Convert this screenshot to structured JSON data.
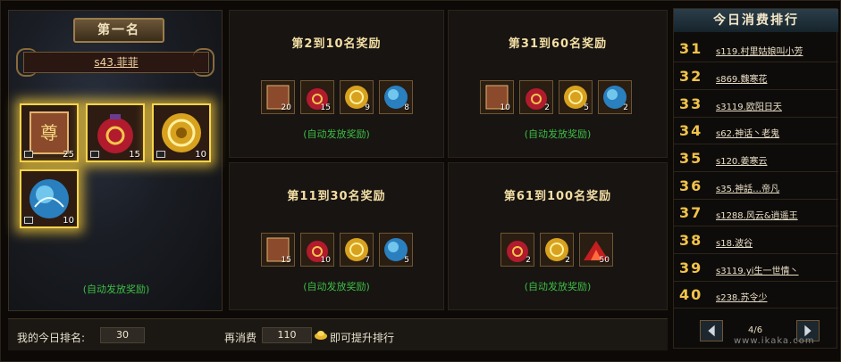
{
  "first_place": {
    "title": "第一名",
    "player": "s43.菲菲",
    "auto_send": "(自动发放奖励)",
    "items": [
      {
        "icon": "token-card-icon",
        "count": "25"
      },
      {
        "icon": "red-bag-icon",
        "count": "15"
      },
      {
        "icon": "gold-coin-icon",
        "count": "10"
      },
      {
        "icon": "blue-orb-icon",
        "count": "10"
      }
    ]
  },
  "reward_panels": [
    {
      "title": "第2到10名奖励",
      "auto_send": "(自动发放奖励)",
      "items": [
        {
          "icon": "token-card-icon",
          "count": "20"
        },
        {
          "icon": "red-bag-icon",
          "count": "15"
        },
        {
          "icon": "gold-coin-icon",
          "count": "9"
        },
        {
          "icon": "blue-orb-icon",
          "count": "8"
        }
      ]
    },
    {
      "title": "第31到60名奖励",
      "auto_send": "(自动发放奖励)",
      "items": [
        {
          "icon": "token-card-icon",
          "count": "10"
        },
        {
          "icon": "red-bag-icon",
          "count": "2"
        },
        {
          "icon": "gold-coin-icon",
          "count": "5"
        },
        {
          "icon": "blue-orb-icon",
          "count": "2"
        }
      ]
    },
    {
      "title": "第11到30名奖励",
      "auto_send": "(自动发放奖励)",
      "items": [
        {
          "icon": "token-card-icon",
          "count": "15"
        },
        {
          "icon": "red-bag-icon",
          "count": "10"
        },
        {
          "icon": "gold-coin-icon",
          "count": "7"
        },
        {
          "icon": "blue-orb-icon",
          "count": "5"
        }
      ]
    },
    {
      "title": "第61到100名奖励",
      "auto_send": "(自动发放奖励)",
      "items": [
        {
          "icon": "red-bag-icon",
          "count": "2"
        },
        {
          "icon": "gold-coin-icon",
          "count": "2"
        },
        {
          "icon": "red-mountain-icon",
          "count": "50"
        }
      ]
    }
  ],
  "bottom": {
    "my_rank_label": "我的今日排名:",
    "my_rank_value": "30",
    "spend_label": "再消费",
    "spend_value": "110",
    "promote_text": "即可提升排行"
  },
  "ranking": {
    "title": "今日消费排行",
    "rows": [
      {
        "rank": "31",
        "name": "s119.村里姑娘叫小芳"
      },
      {
        "rank": "32",
        "name": "s869.魏寒花"
      },
      {
        "rank": "33",
        "name": "s3119.欧阳日天"
      },
      {
        "rank": "34",
        "name": "s62.神话丶老鬼"
      },
      {
        "rank": "35",
        "name": "s120.姜寒云"
      },
      {
        "rank": "36",
        "name": "s35.神話…帝凡"
      },
      {
        "rank": "37",
        "name": "s1288.风云&逍遥王"
      },
      {
        "rank": "38",
        "name": "s18.波谷"
      },
      {
        "rank": "39",
        "name": "s3119.yi生一世情丶"
      },
      {
        "rank": "40",
        "name": "s238.苏令少"
      }
    ],
    "page": "4/6"
  },
  "watermark": "www.ikaka.com",
  "colors": {
    "gold": "#f2c34a",
    "green": "#3dbd44"
  }
}
